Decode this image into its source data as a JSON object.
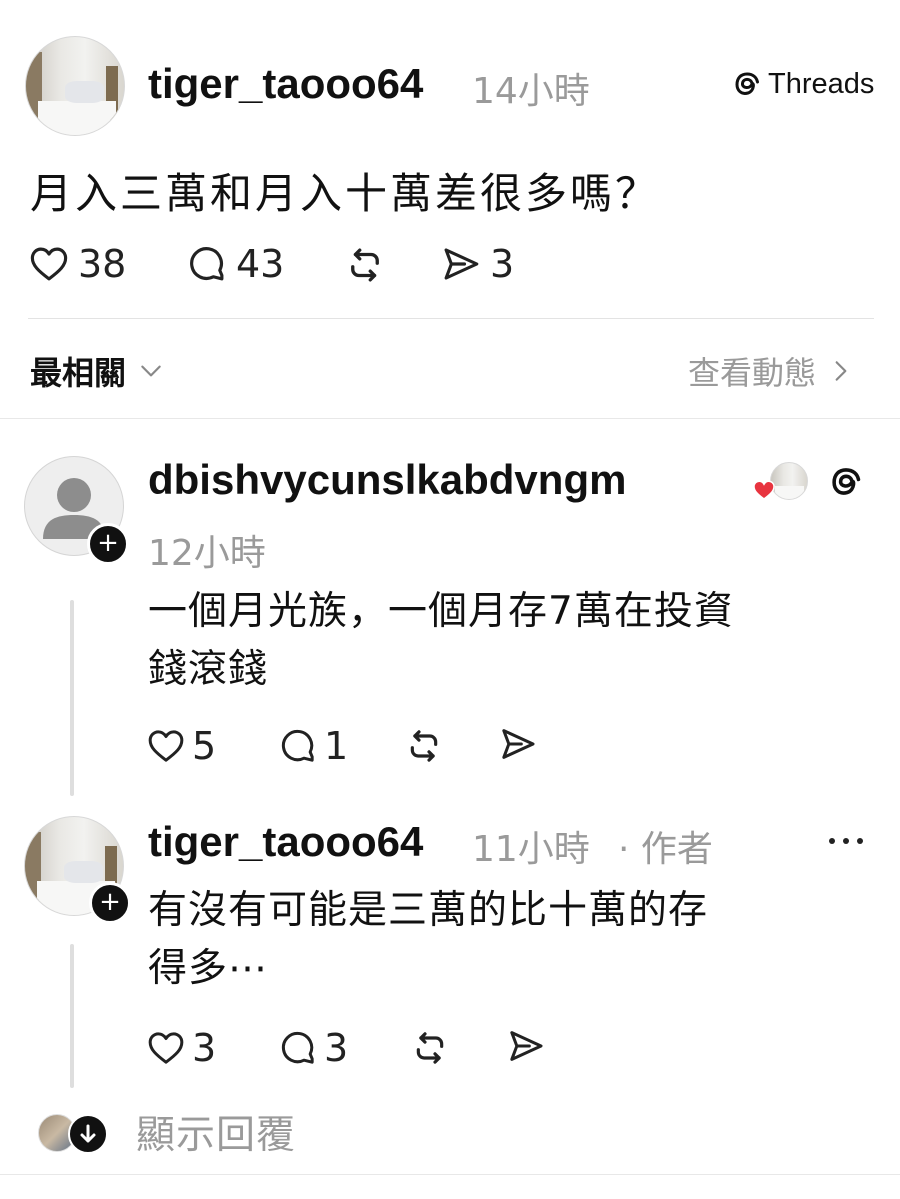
{
  "post": {
    "username": "tiger_taooo64",
    "time": "14小時",
    "badge": "Threads",
    "text": "月入三萬和月入十萬差很多嗎？",
    "likes": "38",
    "comments": "43",
    "shares": "3"
  },
  "sort": {
    "label": "最相關",
    "activity_label": "查看動態"
  },
  "replies": [
    {
      "username": "dbishvycunslkabdvngm",
      "time": "12小時",
      "text_line1": "一個月光族，一個月存7萬在投資",
      "text_line2": "錢滾錢",
      "likes": "5",
      "comments": "1"
    },
    {
      "username": "tiger_taooo64",
      "time": "11小時",
      "author_tag": "· 作者",
      "text_line1": "有沒有可能是三萬的比十萬的存",
      "text_line2": "得多⋯",
      "likes": "3",
      "comments": "3"
    }
  ],
  "show_replies": {
    "label": "顯示回覆"
  },
  "colors": {
    "heart_red": "#e8343f",
    "muted_text": "#9a9a9a"
  }
}
